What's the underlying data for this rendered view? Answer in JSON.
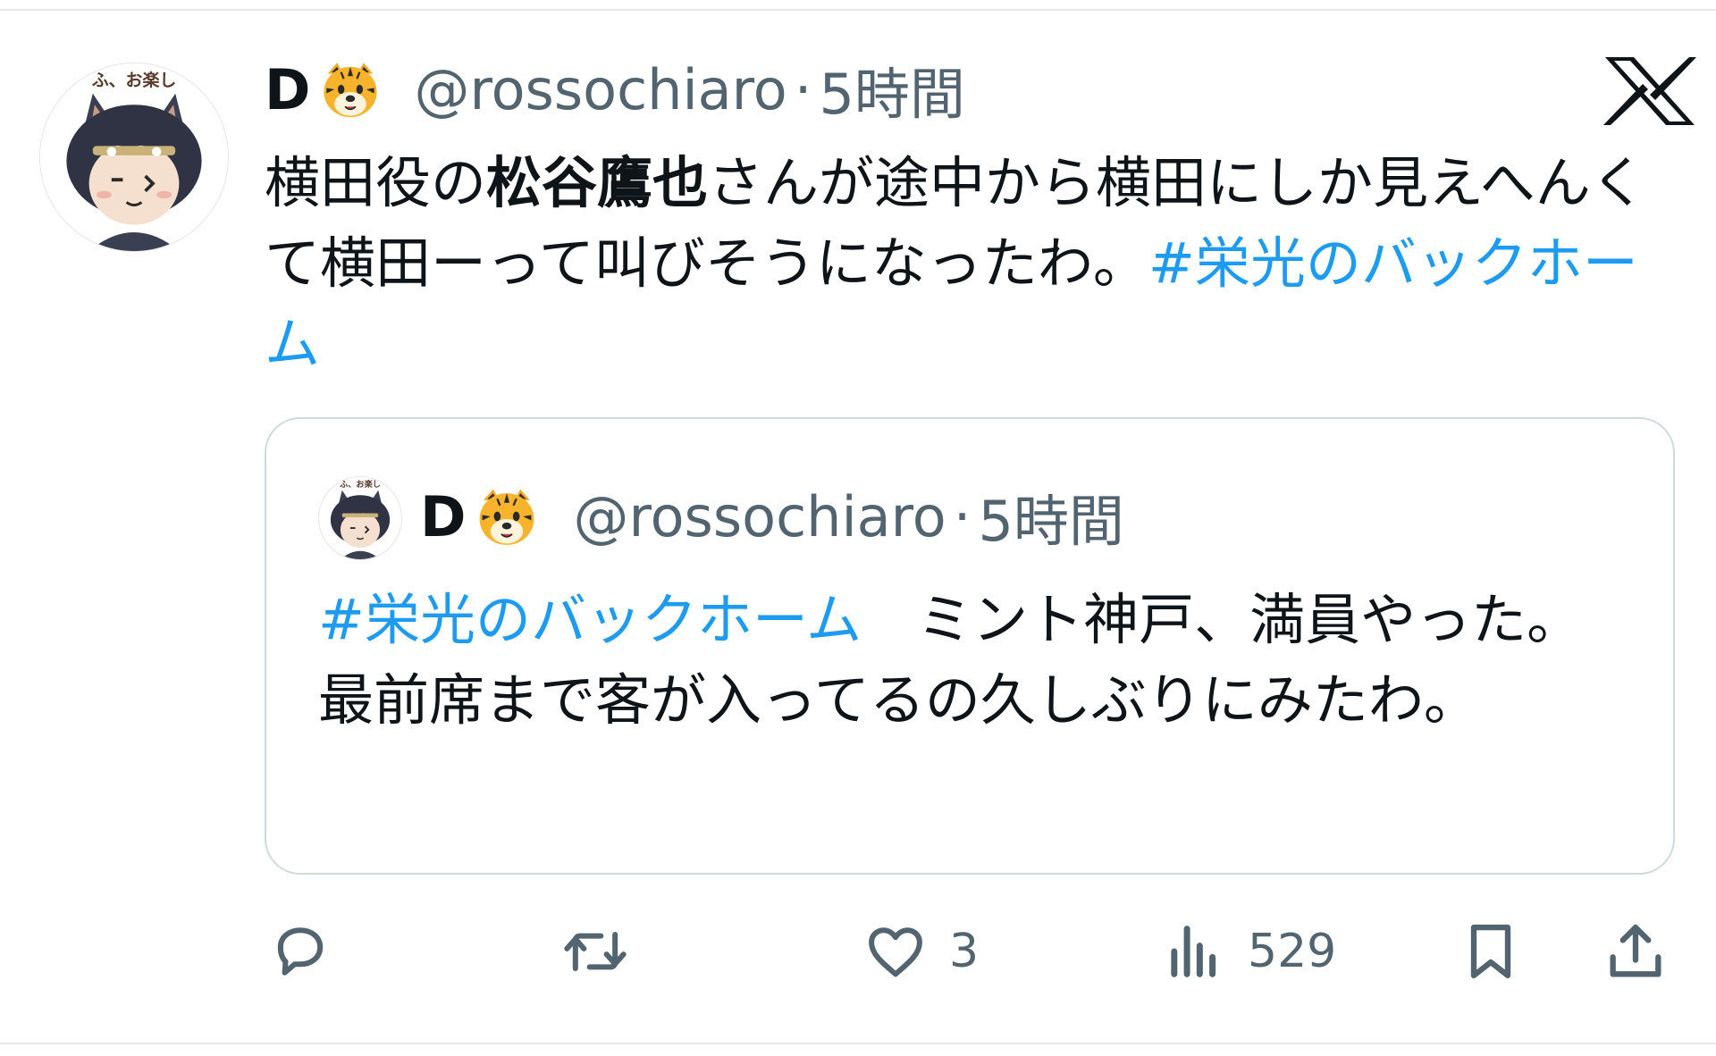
{
  "tweet": {
    "display_name": "D",
    "handle": "@rossochiaro",
    "separator": "·",
    "timestamp": "5時間",
    "text_part1": "横田役の",
    "text_bold": "松谷鷹也",
    "text_part2": "さんが途中から横田にしか見えへんくて横田ーって叫びそうになったわ。",
    "hashtag": "#栄光のバックホーム",
    "avatar_badge_text": "ふ、お楽し"
  },
  "quote": {
    "display_name": "D",
    "handle": "@rossochiaro",
    "separator": "·",
    "timestamp": "5時間",
    "hashtag": "#栄光のバックホーム",
    "text": "ミント神戸、満員やった。最前席まで客が入ってるの久しぶりにみたわ。",
    "avatar_badge_text": "ふ、お楽し"
  },
  "actions": {
    "reply_count": "",
    "retweet_count": "",
    "like_count": "3",
    "views_count": "529"
  },
  "icons": {
    "brand_logo": "x-logo-icon",
    "emoji": "tiger-face-emoji",
    "reply": "reply-icon",
    "retweet": "retweet-icon",
    "like": "heart-icon",
    "views": "views-icon",
    "bookmark": "bookmark-icon",
    "share": "share-icon"
  },
  "colors": {
    "link": "#1d9bf0",
    "secondary_text": "#536471",
    "primary_text": "#0f1419",
    "card_border": "#cfd9de"
  }
}
